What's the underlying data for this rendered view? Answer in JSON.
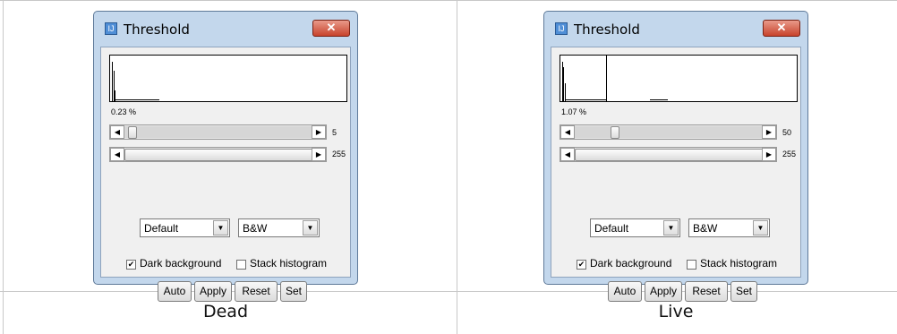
{
  "panels": [
    {
      "caption": "Dead",
      "window": {
        "title": "Threshold",
        "close_glyph": "✕",
        "icon": "imagej-icon",
        "percent": "0.23 %",
        "slider_min_value": "5",
        "slider_min_level": 0.02,
        "slider_max_value": "255",
        "slider_max_level": 1.0,
        "method_select": "Default",
        "mode_select": "B&W",
        "dark_background_label": "Dark background",
        "dark_background_checked": true,
        "stack_histogram_label": "Stack histogram",
        "stack_histogram_checked": false,
        "buttons": {
          "auto": "Auto",
          "apply": "Apply",
          "reset": "Reset",
          "set": "Set"
        }
      }
    },
    {
      "caption": "Live",
      "window": {
        "title": "Threshold",
        "close_glyph": "✕",
        "icon": "imagej-icon",
        "percent": "1.07 %",
        "slider_min_value": "50",
        "slider_min_level": 0.2,
        "slider_max_value": "255",
        "slider_max_level": 1.0,
        "method_select": "Default",
        "mode_select": "B&W",
        "dark_background_label": "Dark background",
        "dark_background_checked": true,
        "stack_histogram_label": "Stack histogram",
        "stack_histogram_checked": false,
        "buttons": {
          "auto": "Auto",
          "apply": "Apply",
          "reset": "Reset",
          "set": "Set"
        }
      }
    }
  ],
  "colors": {
    "window_frame": "#c3d7ec",
    "close_button": "#c8432c",
    "client_background": "#f0f0f0"
  }
}
